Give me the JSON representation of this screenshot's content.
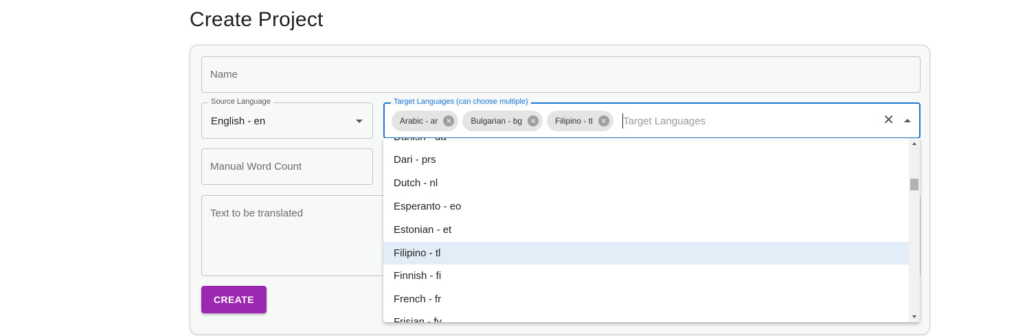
{
  "page": {
    "title": "Create Project"
  },
  "form": {
    "name_placeholder": "Name",
    "source_language": {
      "label": "Source Language",
      "value": "English - en"
    },
    "target_languages": {
      "label": "Target Languages (can choose multiple)",
      "placeholder": "Target Languages",
      "chips": [
        "Arabic - ar",
        "Bulgarian - bg",
        "Filipino - tl"
      ]
    },
    "word_count_placeholder": "Manual Word Count",
    "text_placeholder": "Text to be translated",
    "create_label": "CREATE"
  },
  "dropdown": {
    "options": [
      {
        "label": "Danish - da",
        "selected": false
      },
      {
        "label": "Dari - prs",
        "selected": false
      },
      {
        "label": "Dutch - nl",
        "selected": false
      },
      {
        "label": "Esperanto - eo",
        "selected": false
      },
      {
        "label": "Estonian - et",
        "selected": false
      },
      {
        "label": "Filipino - tl",
        "selected": true
      },
      {
        "label": "Finnish - fi",
        "selected": false
      },
      {
        "label": "French - fr",
        "selected": false
      },
      {
        "label": "Frisian - fy",
        "selected": false
      }
    ]
  },
  "colors": {
    "accent": "#1976d2",
    "button": "#9c27b0",
    "selected_option": "#e3edf8"
  },
  "icons": {
    "source_caret": "chevron-down-icon",
    "target_caret": "chevron-up-icon",
    "clear": "close-icon",
    "chip_delete": "cancel-circle-icon"
  }
}
